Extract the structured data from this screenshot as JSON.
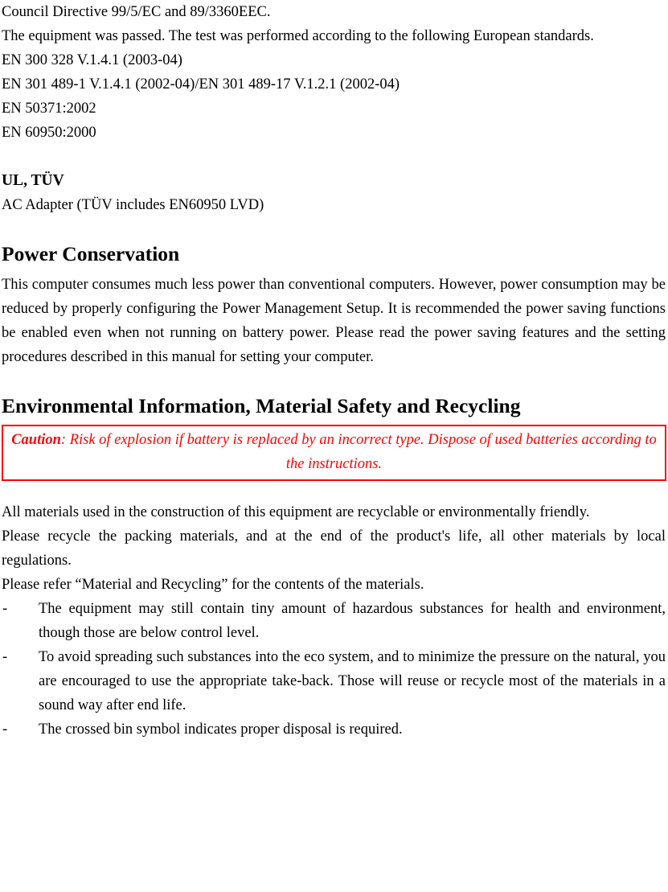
{
  "document": {
    "colors": {
      "text": "#000000",
      "caution_border": "#ff0000",
      "caution_text": "#ff0000",
      "background": "#ffffff"
    },
    "compliance": {
      "line_1": "Council Directive 99/5/EC and 89/3360EEC.",
      "paragraph": "The equipment was passed. The test was performed according to the following European standards.",
      "standards": [
        "EN 300 328 V.1.4.1 (2003-04)",
        "EN 301 489-1 V.1.4.1 (2002-04)/EN 301 489-17 V.1.2.1 (2002-04)",
        "EN 50371:2002",
        "EN 60950:2000"
      ]
    },
    "ul_tuv": {
      "heading": "UL, TÜV",
      "body": "AC Adapter (TÜV includes EN60950 LVD)"
    },
    "power_conservation": {
      "heading": "Power Conservation",
      "paragraph": "This computer consumes much less power than conventional computers. However, power consumption may be reduced by properly configuring the Power Management Setup. It is recommended the power saving functions be enabled even when not running on battery power. Please read the power saving features and the setting procedures described in this manual for setting your computer."
    },
    "environmental": {
      "heading": "Environmental Information, Material Safety and Recycling",
      "caution": {
        "label": "Caution",
        "separator": ": ",
        "text": "Risk of explosion if battery is replaced by an incorrect type. Dispose of used batteries according to the instructions."
      },
      "paragraphs": [
        "All materials used in the construction of this equipment are recyclable or environmentally friendly.",
        "Please recycle the packing materials, and at the end of the product's life, all other materials by local regulations.",
        "Please refer “Material and Recycling” for the contents of the materials."
      ],
      "bullet_marker": "-",
      "bullets": [
        "The equipment may still contain tiny amount of hazardous substances for health and environment, though those are below control level.",
        "To avoid spreading such substances into the eco system, and to minimize the pressure on the natural, you are encouraged to use the appropriate take-back. Those will reuse or recycle most of the materials in a sound way after end life.",
        "The crossed bin symbol indicates proper disposal is required."
      ]
    }
  }
}
